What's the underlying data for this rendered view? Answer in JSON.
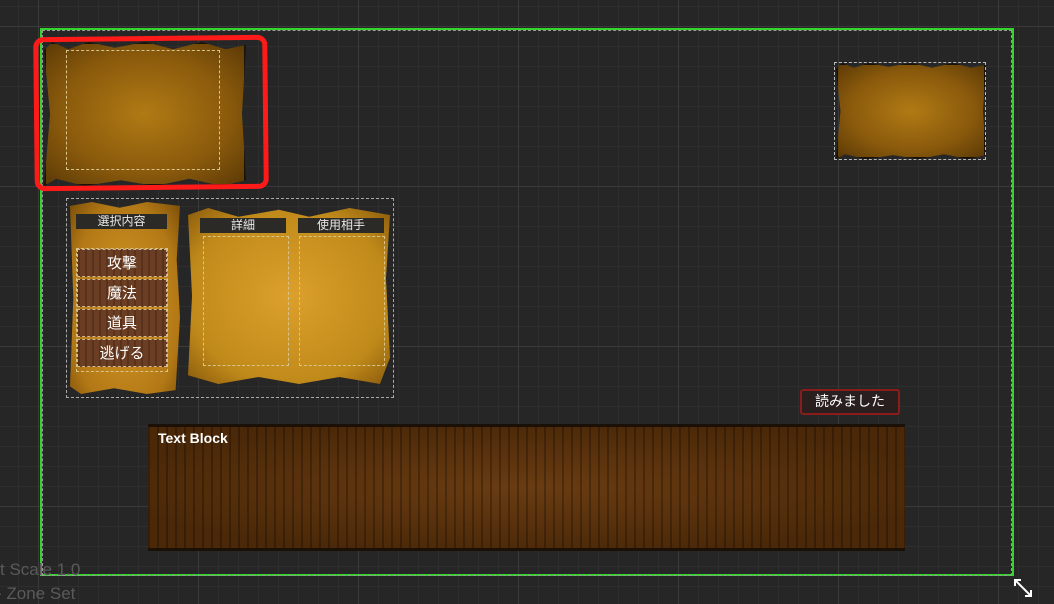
{
  "canvas": {
    "scale_label": "t Scale 1.0",
    "zone_label": "- Zone Set"
  },
  "menu": {
    "selection_header": "選択内容",
    "detail_header": "詳細",
    "target_header": "使用相手",
    "commands": [
      "攻撃",
      "魔法",
      "道具",
      "逃げる"
    ]
  },
  "read_button": {
    "label": "読みました"
  },
  "textbox": {
    "label": "Text Block"
  },
  "colors": {
    "canvas_frame": "#35d42c",
    "selection_highlight": "#ff1a1a",
    "read_button_border": "#8a1c1c"
  }
}
